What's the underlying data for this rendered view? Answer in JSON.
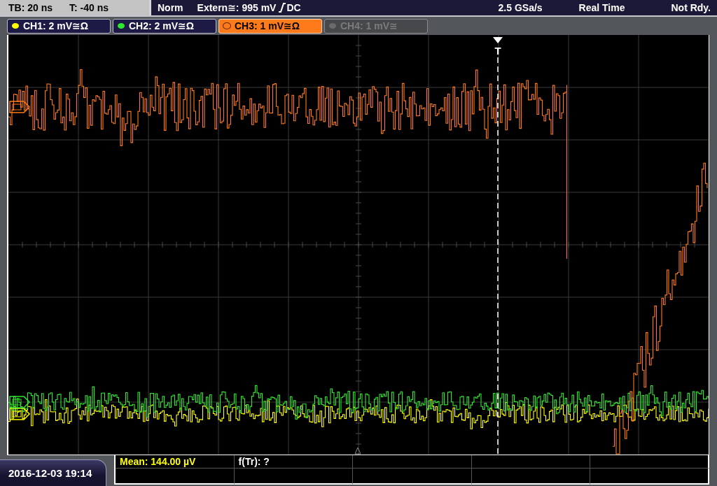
{
  "status_bar": {
    "timebase": "TB: 20 ns",
    "trigger_time": "T: -40 ns",
    "trigger_mode": "Norm",
    "trigger_source": "Extern≅: 995 mV",
    "coupling": "DC",
    "sample_rate": "2.5 GSa/s",
    "acquisition": "Real Time",
    "status": "Not Rdy."
  },
  "channels": [
    {
      "label": "CH1: 2 mV≅Ω",
      "color": "#ffff00",
      "selected": false,
      "disabled": false
    },
    {
      "label": "CH2: 2 mV≅Ω",
      "color": "#2ee82e",
      "selected": false,
      "disabled": false
    },
    {
      "label": "CH3: 1 mV≅Ω",
      "color": "#ff7a1a",
      "selected": true,
      "disabled": false
    },
    {
      "label": "CH4: 1 mV≅",
      "color": "#6a6a6a",
      "selected": false,
      "disabled": true
    }
  ],
  "display": {
    "trigger_label": "T"
  },
  "measurements": [
    {
      "text": "Mean: 144.00 µV",
      "kind": "measured"
    },
    {
      "text": "f(Tr): ?",
      "kind": "pending"
    }
  ],
  "timestamp": "2016-12-03 19:14"
}
